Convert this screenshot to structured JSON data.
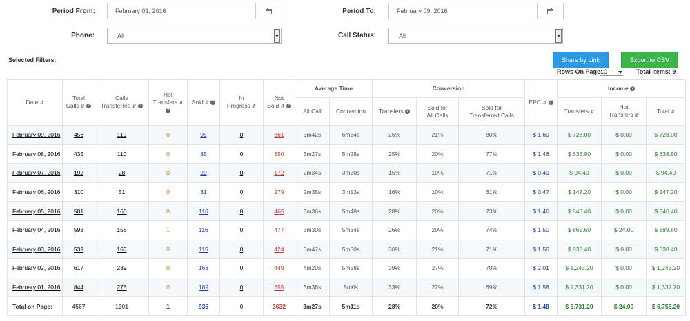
{
  "filters": {
    "period_from_label": "Period From:",
    "period_from_value": "February 01, 2016",
    "period_to_label": "Period To:",
    "period_to_value": "February 09, 2016",
    "phone_label": "Phone:",
    "phone_value": "All",
    "call_status_label": "Call Status:",
    "call_status_value": "All",
    "selected_filters_label": "Selected Filters:"
  },
  "actions": {
    "share_label": "Share by Link",
    "export_label": "Export to CSV"
  },
  "pagination": {
    "rows_on_page_label": "Rows On Page:",
    "rows_on_page_value": "10",
    "total_items_label": "Total Items: 9"
  },
  "table": {
    "group_headers": {
      "average_time": "Average Time",
      "conversion": "Conversion",
      "income": "Income"
    },
    "headers": {
      "date": "Date",
      "total_calls": [
        "Total",
        "Calls"
      ],
      "calls_transferred": [
        "Calls",
        "Transferred"
      ],
      "hot_transfers": [
        "Hot",
        "Transfers"
      ],
      "sold": "Sold",
      "in_progress": [
        "In",
        "Progress"
      ],
      "not_sold": [
        "Not",
        "Sold"
      ],
      "all_call": "All Call",
      "connection": "Connection",
      "transfers": "Transfers",
      "sold_all_calls": [
        "Sold for",
        "All Calls"
      ],
      "sold_transferred": [
        "Sold for",
        "Transferred Calls"
      ],
      "epc": "EPC",
      "income_transfers": "Transfers",
      "income_hot": [
        "Hot",
        "Transfers"
      ],
      "income_total": "Total"
    },
    "rows": [
      {
        "date": "February 09, 2016",
        "total_calls": "456",
        "calls_transferred": "119",
        "hot_transfers": "0",
        "sold": "95",
        "in_progress": "0",
        "not_sold": "361",
        "all_call": "3m42s",
        "connection": "6m34s",
        "transfers": "26%",
        "sold_all": "21%",
        "sold_transferred": "80%",
        "epc": "$ 1.60",
        "inc_transfers": "$ 728.00",
        "inc_hot": "$ 0.00",
        "inc_total": "$ 728.00"
      },
      {
        "date": "February 08, 2016",
        "total_calls": "435",
        "calls_transferred": "110",
        "hot_transfers": "0",
        "sold": "85",
        "in_progress": "0",
        "not_sold": "350",
        "all_call": "3m27s",
        "connection": "5m28s",
        "transfers": "25%",
        "sold_all": "20%",
        "sold_transferred": "77%",
        "epc": "$ 1.46",
        "inc_transfers": "$ 636.80",
        "inc_hot": "$ 0.00",
        "inc_total": "$ 636.80"
      },
      {
        "date": "February 07, 2016",
        "total_calls": "192",
        "calls_transferred": "28",
        "hot_transfers": "0",
        "sold": "20",
        "in_progress": "0",
        "not_sold": "172",
        "all_call": "2m34s",
        "connection": "3m20s",
        "transfers": "15%",
        "sold_all": "10%",
        "sold_transferred": "71%",
        "epc": "$ 0.49",
        "inc_transfers": "$ 94.40",
        "inc_hot": "$ 0.00",
        "inc_total": "$ 94.40"
      },
      {
        "date": "February 06, 2016",
        "total_calls": "310",
        "calls_transferred": "51",
        "hot_transfers": "0",
        "sold": "31",
        "in_progress": "0",
        "not_sold": "279",
        "all_call": "2m35s",
        "connection": "3m13s",
        "transfers": "16%",
        "sold_all": "10%",
        "sold_transferred": "61%",
        "epc": "$ 0.47",
        "inc_transfers": "$ 147.20",
        "inc_hot": "$ 0.00",
        "inc_total": "$ 147.20"
      },
      {
        "date": "February 05, 2016",
        "total_calls": "581",
        "calls_transferred": "160",
        "hot_transfers": "0",
        "sold": "116",
        "in_progress": "0",
        "not_sold": "465",
        "all_call": "3m36s",
        "connection": "5m48s",
        "transfers": "28%",
        "sold_all": "20%",
        "sold_transferred": "73%",
        "epc": "$ 1.46",
        "inc_transfers": "$ 846.40",
        "inc_hot": "$ 0.00",
        "inc_total": "$ 846.40"
      },
      {
        "date": "February 04, 2016",
        "total_calls": "593",
        "calls_transferred": "156",
        "hot_transfers": "1",
        "sold": "116",
        "in_progress": "0",
        "not_sold": "477",
        "all_call": "3m30s",
        "connection": "5m34s",
        "transfers": "26%",
        "sold_all": "20%",
        "sold_transferred": "74%",
        "epc": "$ 1.50",
        "inc_transfers": "$ 865.60",
        "inc_hot": "$ 24.00",
        "inc_total": "$ 889.60"
      },
      {
        "date": "February 03, 2016",
        "total_calls": "539",
        "calls_transferred": "163",
        "hot_transfers": "0",
        "sold": "115",
        "in_progress": "0",
        "not_sold": "424",
        "all_call": "3m47s",
        "connection": "5m50s",
        "transfers": "30%",
        "sold_all": "21%",
        "sold_transferred": "71%",
        "epc": "$ 1.56",
        "inc_transfers": "$ 838.40",
        "inc_hot": "$ 0.00",
        "inc_total": "$ 838.40"
      },
      {
        "date": "February 02, 2016",
        "total_calls": "617",
        "calls_transferred": "239",
        "hot_transfers": "0",
        "sold": "168",
        "in_progress": "0",
        "not_sold": "449",
        "all_call": "4m20s",
        "connection": "5m58s",
        "transfers": "39%",
        "sold_all": "27%",
        "sold_transferred": "70%",
        "epc": "$ 2.01",
        "inc_transfers": "$ 1,243.20",
        "inc_hot": "$ 0.00",
        "inc_total": "$ 1,243.20"
      },
      {
        "date": "February 01, 2016",
        "total_calls": "844",
        "calls_transferred": "275",
        "hot_transfers": "0",
        "sold": "189",
        "in_progress": "0",
        "not_sold": "655",
        "all_call": "3m36s",
        "connection": "5m0s",
        "transfers": "33%",
        "sold_all": "22%",
        "sold_transferred": "69%",
        "epc": "$ 1.58",
        "inc_transfers": "$ 1,331.20",
        "inc_hot": "$ 0.00",
        "inc_total": "$ 1,331.20"
      }
    ],
    "totals": {
      "label": "Total on Page:",
      "total_calls": "4567",
      "calls_transferred": "1301",
      "hot_transfers": "1",
      "sold": "935",
      "in_progress": "0",
      "not_sold": "3632",
      "all_call": "3m27s",
      "connection": "5m11s",
      "transfers": "28%",
      "sold_all": "20%",
      "sold_transferred": "72%",
      "epc": "$ 1.48",
      "inc_transfers": "$ 6,731.20",
      "inc_hot": "$ 24.00",
      "inc_total": "$ 6,755.20"
    }
  }
}
